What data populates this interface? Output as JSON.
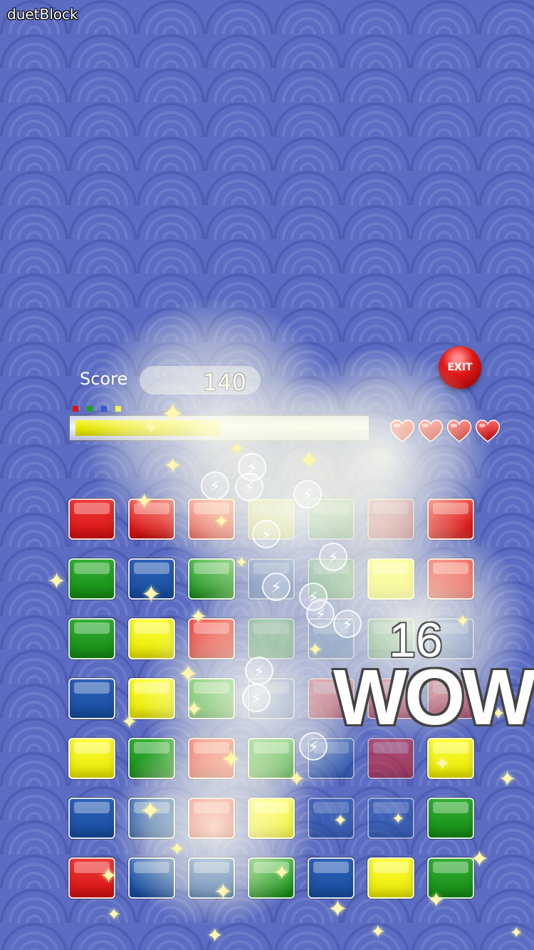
{
  "app": {
    "title": "duetBlock"
  },
  "hud": {
    "score_label": "Score",
    "score_value": "140",
    "exit_label": "EXIT",
    "progress": 0.5,
    "lives": 4,
    "color_keys": [
      "#e01010",
      "#10a010",
      "#1030d0",
      "#f0f000"
    ]
  },
  "combo": {
    "count": "16",
    "word": "WOW"
  },
  "board": {
    "columns": 7,
    "rows": [
      [
        "red",
        "red",
        "red",
        "yellow-fade",
        "green-fade",
        "red-fade",
        "red"
      ],
      [
        "green",
        "blue",
        "green",
        "blue-fade",
        "green-fade",
        "yellow",
        "red"
      ],
      [
        "green",
        "yellow",
        "red",
        "green-fade",
        "blue-fade",
        "green-fade",
        "blue-fade"
      ],
      [
        "blue",
        "yellow",
        "green",
        "blue-fade",
        "red-fade",
        "red-fade",
        "red-fade"
      ],
      [
        "yellow",
        "green",
        "red",
        "green",
        "blue-fade",
        "red-fade",
        "yellow"
      ],
      [
        "blue",
        "blue",
        "red",
        "yellow",
        "blue-fade",
        "blue-fade",
        "green"
      ],
      [
        "red",
        "blue",
        "blue",
        "green",
        "blue",
        "yellow",
        "green"
      ]
    ]
  },
  "icons": {
    "bolt": "⚡",
    "sparkle": "✦"
  }
}
